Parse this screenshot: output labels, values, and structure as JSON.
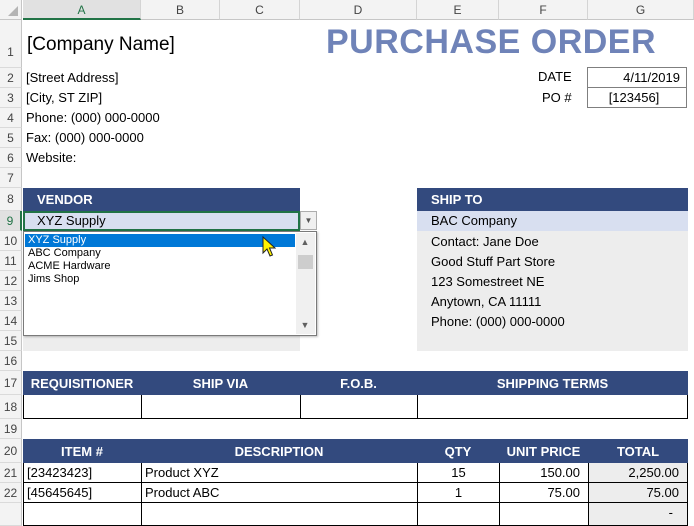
{
  "columns": [
    "A",
    "B",
    "C",
    "D",
    "E",
    "F",
    "G"
  ],
  "rows": [
    "1",
    "2",
    "3",
    "4",
    "5",
    "6",
    "7",
    "8",
    "9",
    "10",
    "11",
    "12",
    "13",
    "14",
    "15",
    "16",
    "17",
    "18",
    "19",
    "20",
    "21",
    "22"
  ],
  "header": {
    "company_name": "[Company Name]",
    "doc_title": "PURCHASE ORDER",
    "street": "[Street Address]",
    "city": "[City, ST  ZIP]",
    "phone": "Phone: (000) 000-0000",
    "fax": "Fax: (000) 000-0000",
    "website": "Website:",
    "date_label": "DATE",
    "date_value": "4/11/2019",
    "po_label": "PO #",
    "po_value": "[123456]"
  },
  "vendor": {
    "heading": "VENDOR",
    "selected": "XYZ Supply",
    "options": [
      "XYZ Supply",
      "ABC Company",
      "ACME Hardware",
      "Jims Shop"
    ]
  },
  "ship_to": {
    "heading": "SHIP TO",
    "name": "BAC Company",
    "contact": "Contact: Jane Doe",
    "store": "Good Stuff Part Store",
    "street": "123 Somestreet NE",
    "city": "Anytown, CA 11111",
    "phone": "Phone: (000) 000-0000"
  },
  "shipping_table": {
    "headers": [
      "REQUISITIONER",
      "SHIP VIA",
      "F.O.B.",
      "SHIPPING TERMS"
    ]
  },
  "items_table": {
    "headers": [
      "ITEM #",
      "DESCRIPTION",
      "QTY",
      "UNIT PRICE",
      "TOTAL"
    ],
    "rows": [
      {
        "item": "[23423423]",
        "description": "Product XYZ",
        "qty": "15",
        "unit_price": "150.00",
        "total": "2,250.00"
      },
      {
        "item": "[45645645]",
        "description": "Product ABC",
        "qty": "1",
        "unit_price": "75.00",
        "total": "75.00"
      },
      {
        "item": "",
        "description": "",
        "qty": "",
        "unit_price": "",
        "total": "-"
      }
    ]
  },
  "colors": {
    "header_bar": "#334a7e",
    "title": "#6f83b8",
    "selection": "#0078d7",
    "excel_green": "#217346"
  }
}
